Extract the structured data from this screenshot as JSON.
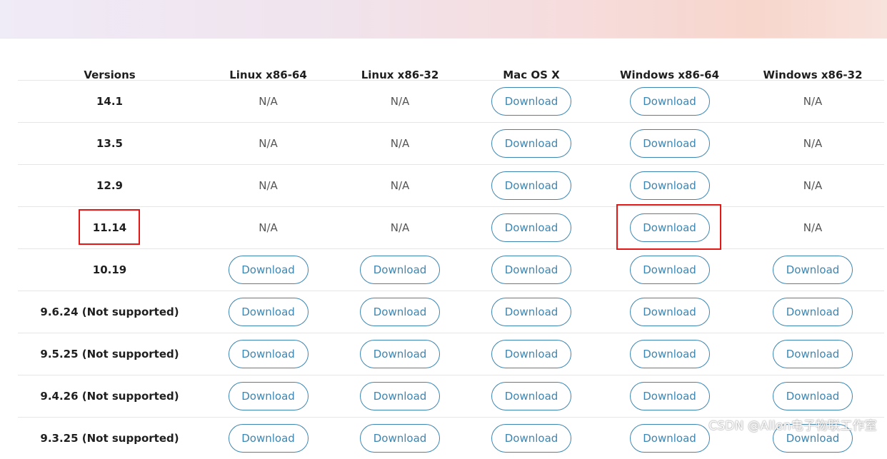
{
  "header": {
    "columns": [
      "Versions",
      "Linux x86-64",
      "Linux x86-32",
      "Mac OS X",
      "Windows x86-64",
      "Windows x86-32"
    ]
  },
  "rows": [
    {
      "version": "14.1",
      "cells": [
        "N/A",
        "N/A",
        "Download",
        "Download",
        "N/A"
      ]
    },
    {
      "version": "13.5",
      "cells": [
        "N/A",
        "N/A",
        "Download",
        "Download",
        "N/A"
      ]
    },
    {
      "version": "12.9",
      "cells": [
        "N/A",
        "N/A",
        "Download",
        "Download",
        "N/A"
      ]
    },
    {
      "version": "11.14",
      "cells": [
        "N/A",
        "N/A",
        "Download",
        "Download",
        "N/A"
      ]
    },
    {
      "version": "10.19",
      "cells": [
        "Download",
        "Download",
        "Download",
        "Download",
        "Download"
      ]
    },
    {
      "version": "9.6.24 (Not supported)",
      "cells": [
        "Download",
        "Download",
        "Download",
        "Download",
        "Download"
      ]
    },
    {
      "version": "9.5.25 (Not supported)",
      "cells": [
        "Download",
        "Download",
        "Download",
        "Download",
        "Download"
      ]
    },
    {
      "version": "9.4.26 (Not supported)",
      "cells": [
        "Download",
        "Download",
        "Download",
        "Download",
        "Download"
      ]
    },
    {
      "version": "9.3.25 (Not supported)",
      "cells": [
        "Download",
        "Download",
        "Download",
        "Download",
        "Download"
      ]
    }
  ],
  "highlights": {
    "note": "red boxes mark version 11.14 and its Windows x86-64 download"
  },
  "watermark": "CSDN @Allen电子物联工作室",
  "colors": {
    "accent": "#3c86b3",
    "highlight": "#e51616"
  }
}
